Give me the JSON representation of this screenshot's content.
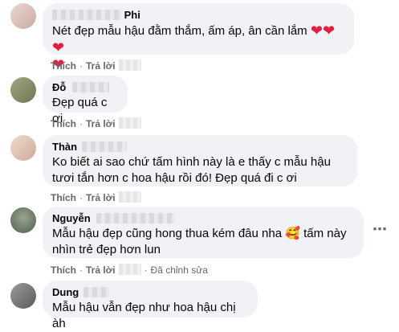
{
  "comments": [
    {
      "name_visible": "Phi",
      "text": "Nét đẹp mẫu hậu đằm thắm, ấm áp, ân cần lắm",
      "like": "Thích",
      "reply": "Trả lời",
      "avatar_color": "#d8c2bd"
    },
    {
      "name_visible": "Đỗ",
      "text": "Đẹp quá c ơi",
      "like": "Thích",
      "reply": "Trả lời",
      "avatar_color": "#8a8f6e"
    },
    {
      "name_visible": "Thàn",
      "text": "Ko biết ai sao chứ tấm hình này là e thấy c mẫu hậu tươi tắn hơn c hoa hậu rồi đó! Đẹp quá đi c ơi",
      "like": "Thích",
      "reply": "Trả lời",
      "avatar_color": "#e0c8b8"
    },
    {
      "name_visible": "Nguyễn",
      "text_before_emoji": "Mẫu hậu đẹp cũng hong thua kém đâu nha",
      "emoji": "🥰",
      "text_after_emoji": "tấm này nhìn trẻ đẹp hơn lun",
      "like": "Thích",
      "reply": "Trả lời",
      "edited": "Đã chỉnh sửa",
      "avatar_color": "#6d7b6a"
    },
    {
      "name_visible": "Dung",
      "text": "Mẫu hậu vẫn đẹp như hoa hậu chị àh",
      "avatar_color": "#7a7a7a"
    }
  ],
  "separator": "·",
  "more_icon": "⋯",
  "heart_icon": "❤"
}
